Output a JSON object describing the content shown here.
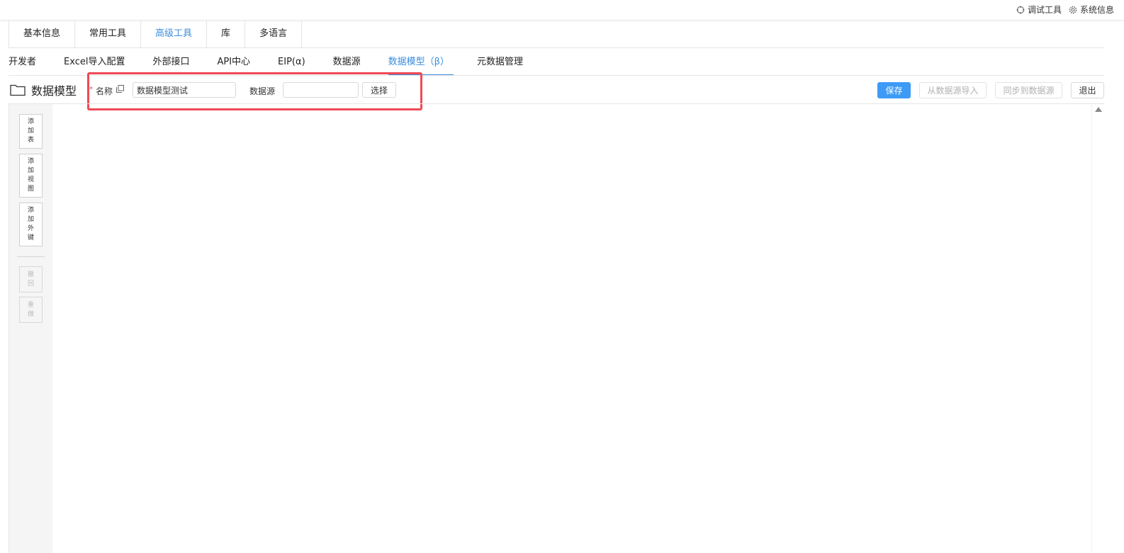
{
  "topbar": {
    "debug_tools": "调试工具",
    "system_info": "系统信息"
  },
  "main_tabs": [
    {
      "label": "基本信息",
      "active": false
    },
    {
      "label": "常用工具",
      "active": false
    },
    {
      "label": "高级工具",
      "active": true
    },
    {
      "label": "库",
      "active": false
    },
    {
      "label": "多语言",
      "active": false
    }
  ],
  "sub_tabs": [
    {
      "label": "开发者",
      "active": false
    },
    {
      "label": "Excel导入配置",
      "active": false
    },
    {
      "label": "外部接口",
      "active": false
    },
    {
      "label": "API中心",
      "active": false
    },
    {
      "label": "EIP(α)",
      "active": false
    },
    {
      "label": "数据源",
      "active": false
    },
    {
      "label": "数据模型（β）",
      "active": true
    },
    {
      "label": "元数据管理",
      "active": false
    }
  ],
  "toolbar": {
    "title": "数据模型",
    "name_label": "名称",
    "name_value": "数据模型测试",
    "datasource_label": "数据源",
    "datasource_value": "",
    "select_label": "选择",
    "save_label": "保存",
    "import_label": "从数据源导入",
    "sync_label": "同步到数据源",
    "exit_label": "退出"
  },
  "left_panel": {
    "add_table": [
      "添",
      "加",
      "表"
    ],
    "add_view": [
      "添",
      "加",
      "视",
      "图"
    ],
    "add_foreign_key": [
      "添",
      "加",
      "外",
      "键"
    ],
    "undo": [
      "撤",
      "回"
    ],
    "redo": [
      "重",
      "做"
    ]
  },
  "colors": {
    "accent": "#3c8dde",
    "primary_button": "#3d9bf5",
    "highlight_border": "#ef4a55"
  }
}
